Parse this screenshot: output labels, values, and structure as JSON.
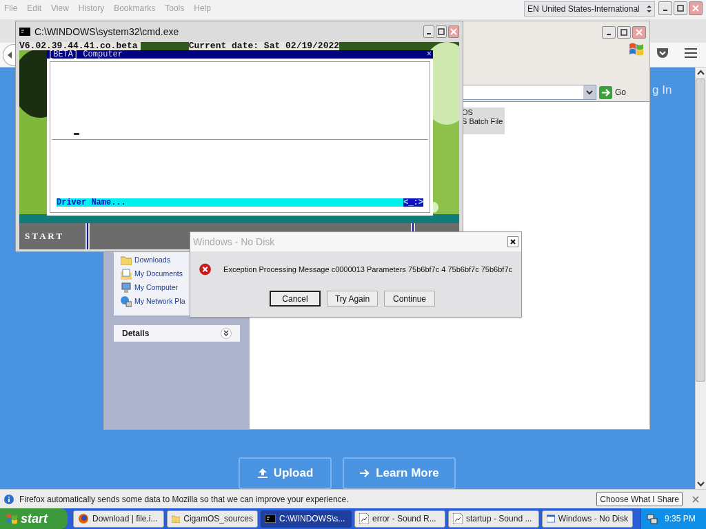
{
  "browser": {
    "menu": [
      "File",
      "Edit",
      "View",
      "History",
      "Bookmarks",
      "Tools",
      "Help"
    ],
    "language_bar": {
      "code": "EN",
      "layout": "United States-International"
    },
    "page": {
      "login_link": "g In",
      "buttons": [
        {
          "label": "Upload",
          "kind": "upload"
        },
        {
          "label": "Learn More",
          "kind": "learn"
        }
      ]
    },
    "notification": {
      "message": "Firefox automatically sends some data to Mozilla so that we can improve your experience.",
      "button": "Choose What I Share"
    }
  },
  "explorer": {
    "address_button": "Go",
    "places": [
      {
        "label": "Downloads",
        "kind": "folder"
      },
      {
        "label": "My Documents",
        "kind": "documents"
      },
      {
        "label": "My Computer",
        "kind": "computer"
      },
      {
        "label": "My Network Pla",
        "kind": "network"
      }
    ],
    "details_title": "Details",
    "file_lines": [
      "OS",
      "S Batch File"
    ]
  },
  "console": {
    "title": "C:\\WINDOWS\\system32\\cmd.exe",
    "version": "V6.02.39.44.41.co.beta",
    "date": "Current date: Sat 02/19/2022",
    "dialog": {
      "title": "[BETA] Computer",
      "close": "×",
      "prompt": "Driver Name...",
      "hint": "<_:>"
    },
    "start": "S T A R T"
  },
  "error_dialog": {
    "title": "Windows - No Disk",
    "message": "Exception Processing Message c0000013 Parameters 75b6bf7c 4 75b6bf7c 75b6bf7c",
    "buttons": [
      {
        "label": "Cancel",
        "selected": true
      },
      {
        "label": "Try Again",
        "selected": false
      },
      {
        "label": "Continue",
        "selected": false
      }
    ]
  },
  "taskbar": {
    "start": "start",
    "tasks": [
      {
        "label": "Download | file.i...",
        "kind": "firefox",
        "selected": false
      },
      {
        "label": "CigamOS_sources",
        "kind": "folder",
        "selected": false
      },
      {
        "label": "C:\\WINDOWS\\s...",
        "kind": "console",
        "selected": true
      },
      {
        "label": "error - Sound R...",
        "kind": "sound",
        "selected": false
      },
      {
        "label": "startup - Sound ...",
        "kind": "sound",
        "selected": false
      },
      {
        "label": "Windows - No Disk",
        "kind": "window",
        "selected": false
      }
    ],
    "clock": "9:35 PM"
  }
}
